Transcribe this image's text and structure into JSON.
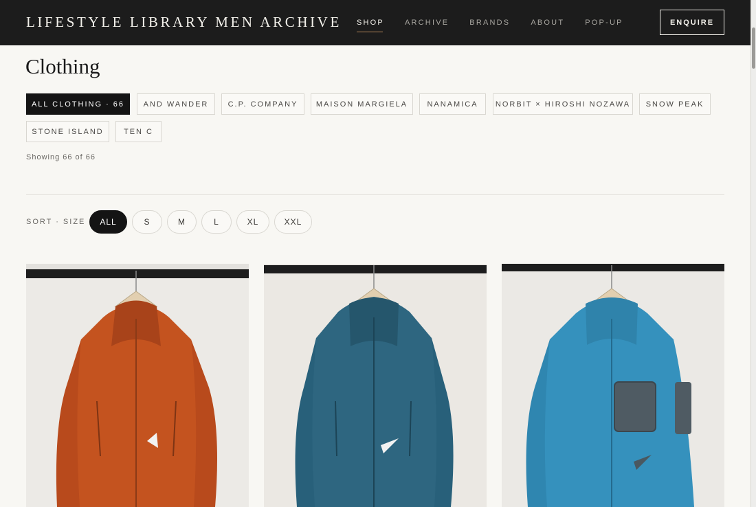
{
  "header": {
    "logo": "LIFESTYLE LIBRARY MEN ARCHIVE",
    "nav": [
      "SHOP",
      "ARCHIVE",
      "BRANDS",
      "ABOUT",
      "POP-UP"
    ],
    "active_nav": "SHOP",
    "enquire_label": "ENQUIRE"
  },
  "page": {
    "title": "Clothing",
    "showing": "Showing 66 of 66"
  },
  "brand_filters": [
    "ALL CLOTHING · 66",
    "AND WANDER",
    "C.P. COMPANY",
    "MAISON MARGIELA",
    "NANAMICA",
    "NORBIT × HIROSHI NOZAWA",
    "SNOW PEAK",
    "STONE ISLAND",
    "TEN C"
  ],
  "active_brand_filter": "ALL CLOTHING · 66",
  "size_filter": {
    "label": "SORT · SIZE",
    "options": [
      "ALL",
      "S",
      "M",
      "L",
      "XL",
      "XXL"
    ],
    "selected": "ALL"
  },
  "products": [
    {
      "image": "orange hooded shell jacket on hanger",
      "color": "#c4531f"
    },
    {
      "image": "teal-blue hooded shell jacket on hanger",
      "color": "#2e6680"
    },
    {
      "image": "bright blue hooded jacket with mesh pocket on hanger",
      "color": "#3591bd"
    }
  ]
}
